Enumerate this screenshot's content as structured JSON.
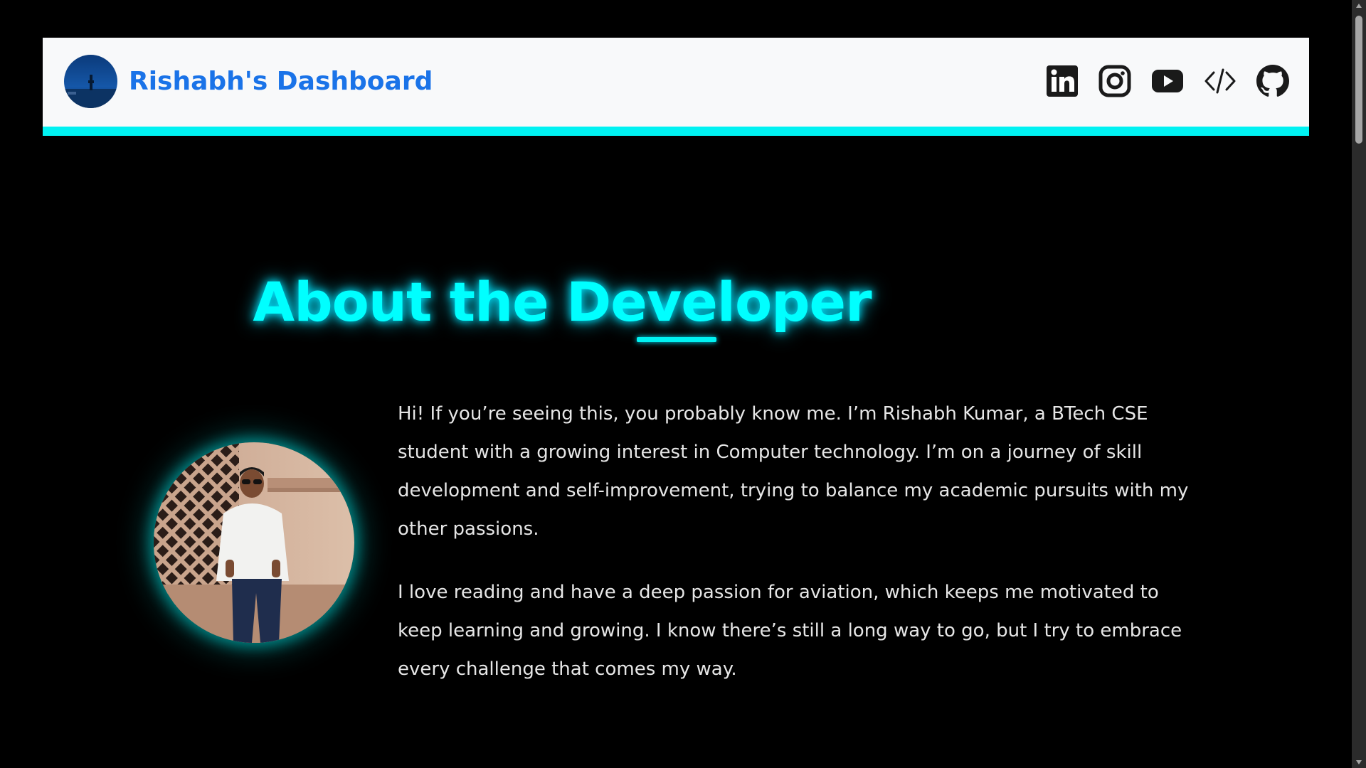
{
  "navbar": {
    "brand_name": "Rishabh's Dashboard",
    "brand_color": "#1a73e8",
    "accent_color": "#00f2f2",
    "social_links": [
      {
        "icon": "linkedin-icon"
      },
      {
        "icon": "instagram-icon"
      },
      {
        "icon": "youtube-icon"
      },
      {
        "icon": "code-icon"
      },
      {
        "icon": "github-icon"
      }
    ]
  },
  "about": {
    "heading": "About the Developer",
    "heading_color": "#00ffff",
    "paragraphs": [
      "Hi! If you’re seeing this, you probably know me. I’m Rishabh Kumar, a BTech CSE student with a growing interest in Computer technology. I’m on a journey of skill development and self-improvement, trying to balance my academic pursuits with my other passions.",
      "I love reading and have a deep passion for aviation, which keeps me motivated to keep learning and growing. I know there’s still a long way to go, but I try to embrace every challenge that comes my way."
    ],
    "photo": "developer-portrait"
  },
  "page": {
    "background": "#000000"
  }
}
